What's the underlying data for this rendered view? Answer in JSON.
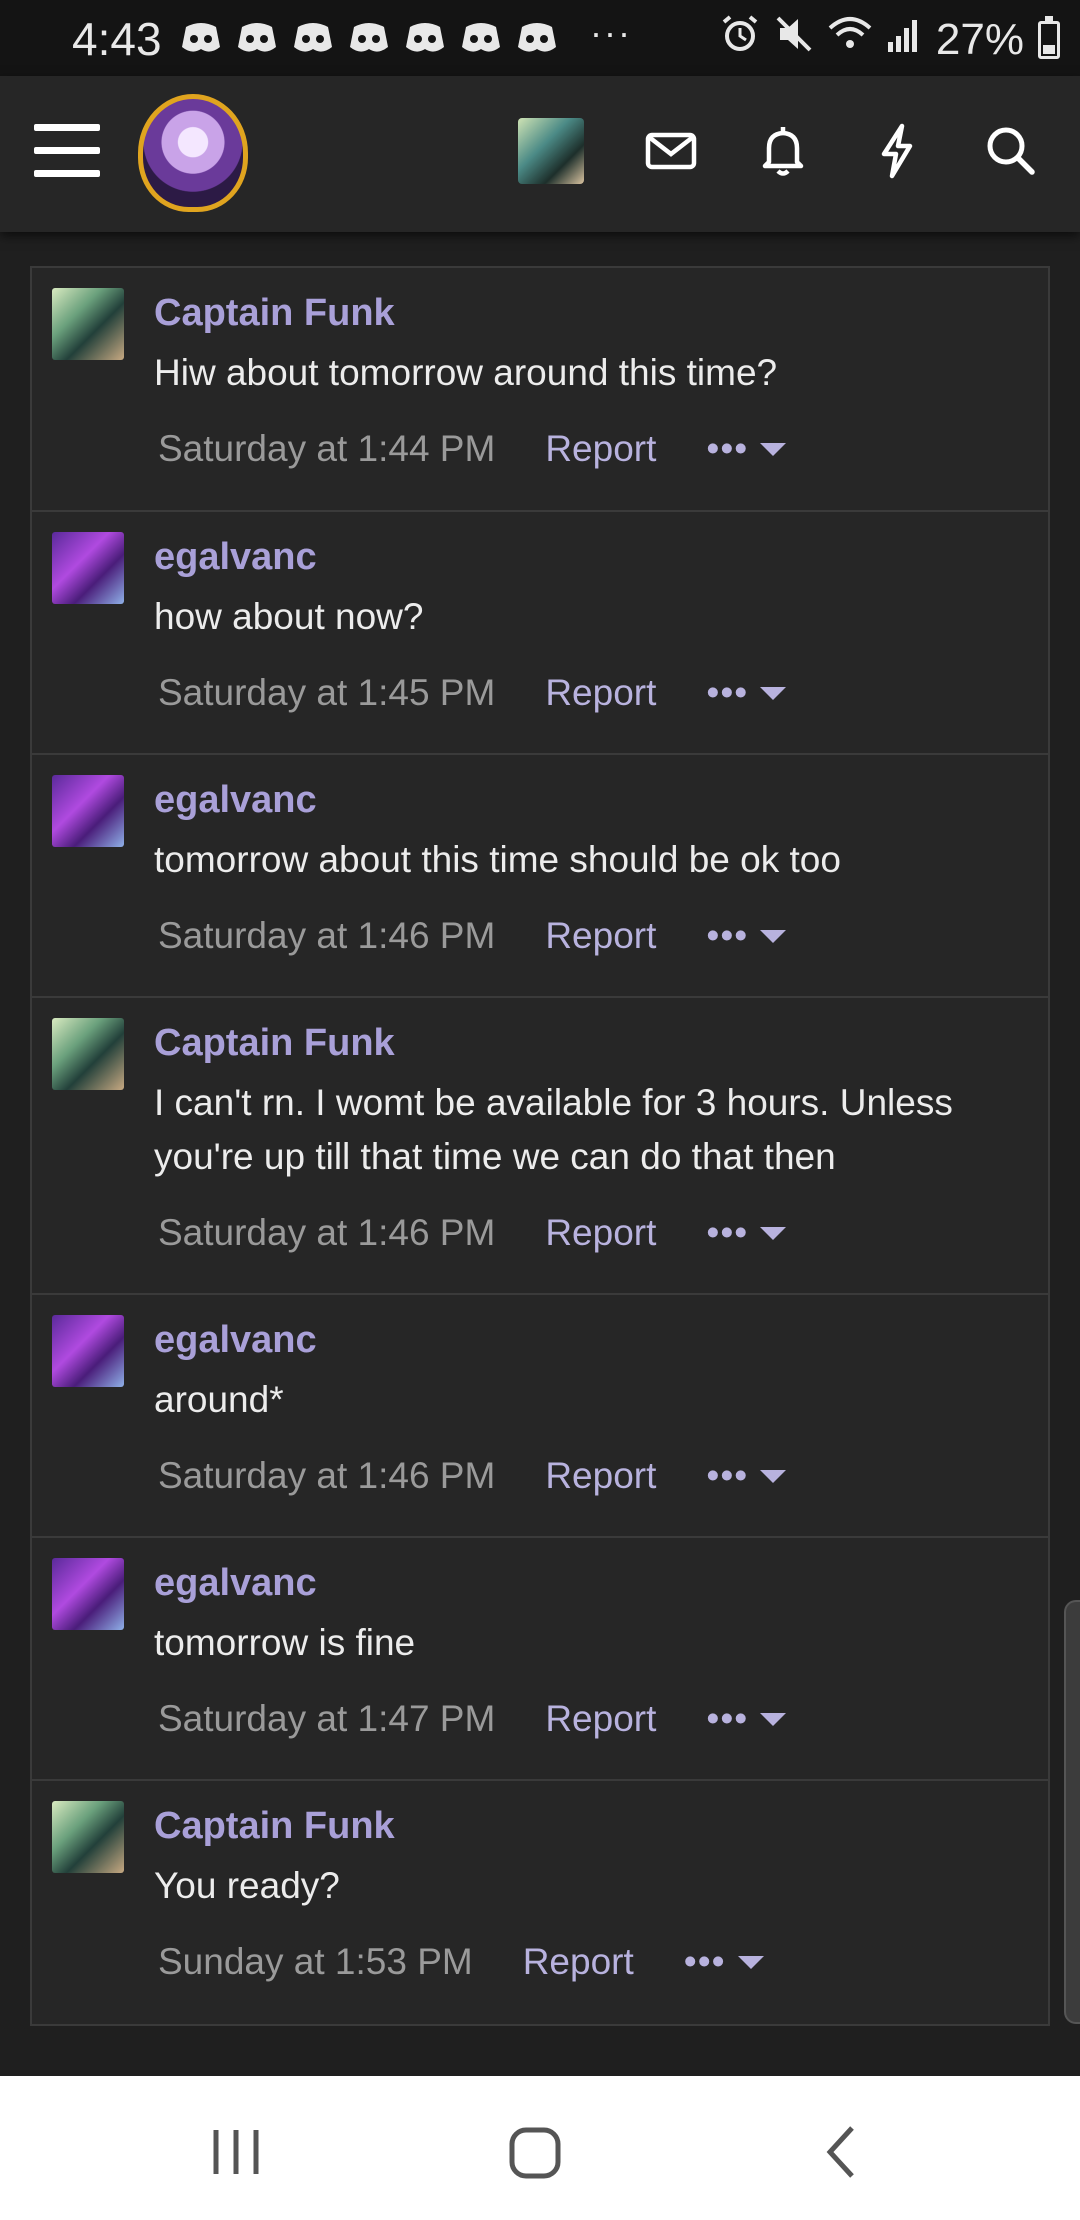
{
  "status_bar": {
    "time": "4:43",
    "more_dots": "···",
    "battery": "27%"
  },
  "app_bar": {
    "icons": [
      "menu-icon",
      "forum-logo",
      "user-avatar",
      "mail-icon",
      "bell-icon",
      "bolt-icon",
      "search-icon"
    ]
  },
  "messages": [
    {
      "user": "Captain Funk",
      "text": "Hiw about tomorrow around this time?",
      "time": "Saturday at 1:44 PM",
      "report": "Report",
      "more": "•••",
      "avatar": "funk"
    },
    {
      "user": "egalvanc",
      "text": "how about now?",
      "time": "Saturday at 1:45 PM",
      "report": "Report",
      "more": "•••",
      "avatar": "egal"
    },
    {
      "user": "egalvanc",
      "text": "tomorrow about this time should be ok too",
      "time": "Saturday at 1:46 PM",
      "report": "Report",
      "more": "•••",
      "avatar": "egal"
    },
    {
      "user": "Captain Funk",
      "text": "I can't rn. I womt be available for 3 hours. Unless you're up till that time we can do that then",
      "time": "Saturday at 1:46 PM",
      "report": "Report",
      "more": "•••",
      "avatar": "funk"
    },
    {
      "user": "egalvanc",
      "text": "around*",
      "time": "Saturday at 1:46 PM",
      "report": "Report",
      "more": "•••",
      "avatar": "egal"
    },
    {
      "user": "egalvanc",
      "text": "tomorrow is fine",
      "time": "Saturday at 1:47 PM",
      "report": "Report",
      "more": "•••",
      "avatar": "egal"
    },
    {
      "user": "Captain Funk",
      "text": "You ready?",
      "time": "Sunday at 1:53 PM",
      "report": "Report",
      "more": "•••",
      "avatar": "funk"
    }
  ],
  "nav_bar": {
    "icons": [
      "recents-icon",
      "home-icon",
      "back-icon"
    ]
  },
  "colors": {
    "username": "#a9a0d8",
    "link": "#b8b2de",
    "background": "#262626"
  }
}
